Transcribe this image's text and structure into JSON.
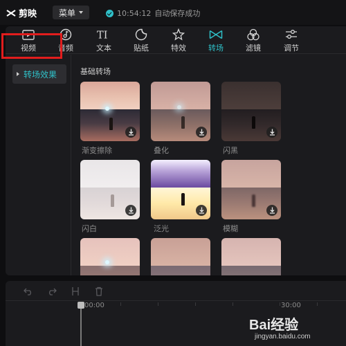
{
  "app": {
    "name": "剪映",
    "menu_label": "菜单"
  },
  "status": {
    "time": "10:54:12",
    "text": "自动保存成功",
    "accent": "#2fc0c8"
  },
  "tabs": [
    {
      "label": "视频",
      "icon": "video-icon"
    },
    {
      "label": "音频",
      "icon": "audio-icon"
    },
    {
      "label": "文本",
      "icon": "text-icon"
    },
    {
      "label": "贴纸",
      "icon": "sticker-icon"
    },
    {
      "label": "特效",
      "icon": "effects-icon"
    },
    {
      "label": "转场",
      "icon": "transition-icon",
      "active": true
    },
    {
      "label": "滤镜",
      "icon": "filter-icon"
    },
    {
      "label": "调节",
      "icon": "adjust-icon"
    }
  ],
  "sidebar": {
    "items": [
      {
        "label": "转场效果",
        "active": true
      }
    ]
  },
  "section": {
    "title": "基础转场"
  },
  "effects": [
    {
      "label": "渐变擦除"
    },
    {
      "label": "叠化"
    },
    {
      "label": "闪黑"
    },
    {
      "label": "闪白"
    },
    {
      "label": "泛光"
    },
    {
      "label": "模糊"
    }
  ],
  "timeline": {
    "start_label": "00:00",
    "mark_label": "30:00",
    "tools": [
      "undo-icon",
      "redo-icon",
      "split-icon",
      "delete-icon"
    ]
  },
  "watermark": {
    "brand": "Bai经验",
    "url": "jingyan.baidu.com"
  }
}
